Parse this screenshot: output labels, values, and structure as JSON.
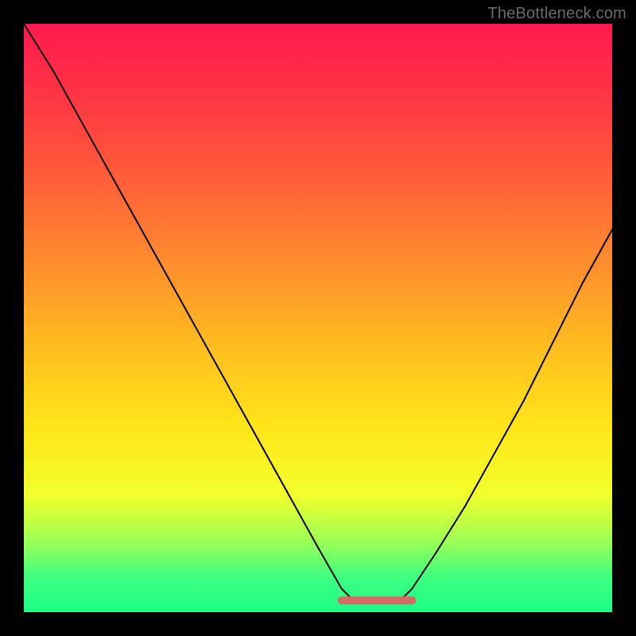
{
  "watermark": "TheBottleneck.com",
  "colors": {
    "background": "#000000",
    "watermark_text": "#6a6a6a",
    "curve": "#000000",
    "flat_segment": "#d86a66",
    "gradient_stops": [
      {
        "offset": 0.0,
        "color": "#ff1a4d"
      },
      {
        "offset": 0.1,
        "color": "#ff2f47"
      },
      {
        "offset": 0.25,
        "color": "#ff5a3a"
      },
      {
        "offset": 0.4,
        "color": "#ff8b2e"
      },
      {
        "offset": 0.55,
        "color": "#ffbd1f"
      },
      {
        "offset": 0.68,
        "color": "#ffe419"
      },
      {
        "offset": 0.8,
        "color": "#f3ff2b"
      },
      {
        "offset": 0.88,
        "color": "#9bff55"
      },
      {
        "offset": 0.94,
        "color": "#3fff7f"
      },
      {
        "offset": 1.0,
        "color": "#1aff88"
      }
    ]
  },
  "chart_data": {
    "type": "line",
    "title": "",
    "xlabel": "",
    "ylabel": "",
    "xlim": [
      0,
      100
    ],
    "ylim": [
      0,
      100
    ],
    "grid": false,
    "x": [
      0,
      5,
      10,
      15,
      20,
      25,
      30,
      35,
      40,
      45,
      50,
      54,
      56,
      60,
      64,
      66,
      70,
      75,
      80,
      85,
      90,
      95,
      100
    ],
    "values": [
      100,
      92,
      83,
      74,
      65,
      56,
      47,
      38,
      29,
      20,
      11,
      4,
      2,
      2,
      2,
      4,
      10,
      18,
      27,
      36,
      46,
      56,
      65
    ],
    "flat_segment": {
      "x_start": 54,
      "x_end": 66,
      "y": 2
    },
    "notes": "Values are approximate readings (0–100 scale on both axes) of the black V-shaped curve on the vertical rainbow gradient. The flat pink/red segment near the bottom spans roughly x=54 to x=66 at y≈2."
  }
}
